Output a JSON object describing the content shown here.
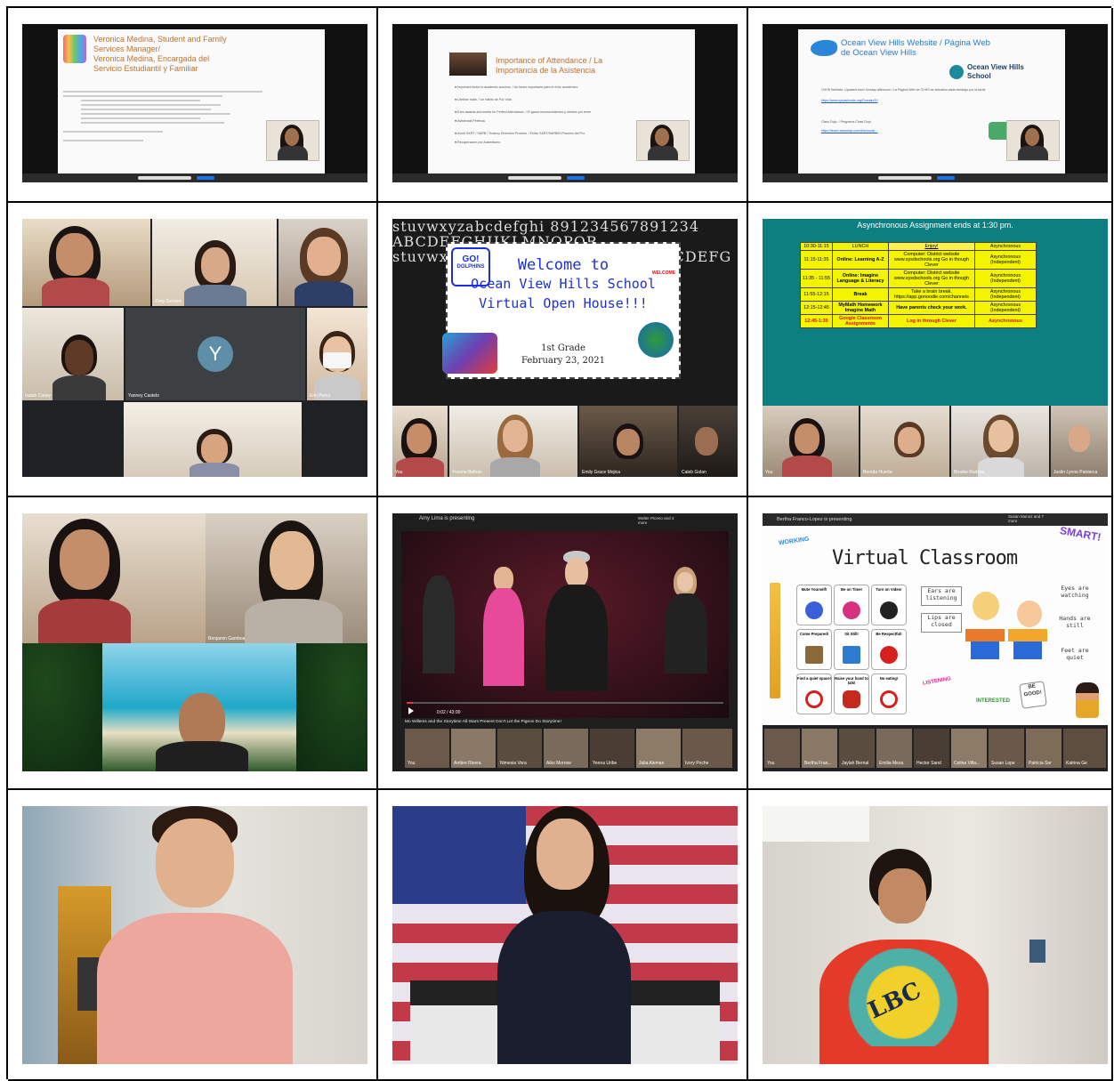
{
  "slide1": {
    "title": "Veronica Medina, Student and Family Services Manager/ Veronica Medina, Encargada del Servicio Estudiantil y Familiar",
    "line1": "Veronica Medina, Student and Family",
    "line2": "Services Manager/",
    "line3": "Veronica Medina, Encargada del",
    "line4": "Servicio Estudiantil y Familiar"
  },
  "slide2": {
    "line1": "Importance of Attendance / La",
    "line2": "Importancia de la Asistencia",
    "bullets": [
      "Important factor to academic success. / Un factor importante para el éxito académico.",
      "Lifetime habit. / Un hábito de Por Vida",
      "Earn awards and merits for Perfect Attendance. / El ganar reconocimientos y méritos por tener",
      "Asistencia Perfecta.",
      "Avoid SART / SARB / Truancy Diversion Process. / Evitar SART/SARB/El Proceso del Pro",
      "Recuperación por Ausentismo."
    ]
  },
  "slide3": {
    "line1": "Ocean View Hills Website / Página Web",
    "line2": "de Ocean View Hills",
    "logo1": "Ocean View Hills",
    "logo2": "School",
    "text1": "OVHS Website- Updated each Sunday afternoon / La Página Web de OVHS se actualiza cada domingo por la tarde",
    "link1": "https://www.sysdschools.org/Domain/10",
    "text2": "Class Dojo- / Programa Class Dojo",
    "link2": "https://teach.classdojo.com/#/schools/..."
  },
  "meet1": {
    "names": [
      "Zoey Serrano",
      "Isaiah Casey",
      "Yanney Castelo",
      "Erin Perez"
    ],
    "avatar_letter": "Y"
  },
  "welcome": {
    "badge_top": "GO!",
    "badge_bottom": "DOLPHINS",
    "l1": "Welcome to",
    "l2": "Ocean View Hills School",
    "l3": "Virtual Open House!!!",
    "grade": "1st Grade",
    "date": "February 23, 2021",
    "stamp": "WELCOME",
    "chalk": "stuvwxyzabcdefghi 891234567891234 ABCDEFGHIJKLMNOPQR stuvwxyzabcdefgh 912345678 ZABCDEFG",
    "names": [
      "You",
      "Yvonne Beltran",
      "Emily Grace Mojica",
      "Caleb Golan"
    ]
  },
  "schedule": {
    "header": "Asynchronous Assignment ends at 1:30 pm.",
    "rows": [
      [
        "10:30-11:15",
        "LUNCH",
        "Enjoy!",
        "Asynchronous"
      ],
      [
        "11:15-11:35",
        "Online: Learning A-Z",
        "Computer: District website www.sysdschools.org Go in though Clever",
        "Asynchronous (Independent)"
      ],
      [
        "11:35 - 11:55",
        "Online: Imagine Language & Literacy",
        "Computer: District website www.sysdschools.org Go in though Clever",
        "Asynchronous (Independent)"
      ],
      [
        "11:55-12:15",
        "Break",
        "Take a brain break, https://app.gonoodle.com/channels",
        "Asynchronous (Independent)"
      ],
      [
        "12:15-12:45",
        "MyMath Homework Imagine Math",
        "Have parents check your work.",
        "Asynchronous (Independent)"
      ],
      [
        "12:45-1:30",
        "Google Classroom Assignments",
        "Log in through Clever",
        "Asynchronous"
      ]
    ],
    "names": [
      "You",
      "Brenda Huerta",
      "Brooke Rudzya",
      "Justin Lynne Patriarca"
    ]
  },
  "meet2": {
    "name": "Benjamin Gamboa"
  },
  "storytime": {
    "presenting": "Amy Lima is presenting",
    "participants": "Walter Piceno and 4 more",
    "video_title": "Mo Willems and the Storytime All-Stars Present Don't Let the Pigeon Do Storytime!",
    "time": "0:02 / 43:00",
    "names": [
      "You",
      "Ambre Rivera",
      "Nimesia Vora",
      "Aiko Morrow",
      "Yenna Uribe",
      "Julia Aleman",
      "Ivory Poche"
    ]
  },
  "classroom": {
    "presenting": "Bertha Franco-Lopez is presenting",
    "participants": "Susan Munoz and 7 more",
    "working": "WORKING",
    "title": "Virtual Classroom",
    "smart": "SMART!",
    "boxes": [
      {
        "label": "Mute Yourself!",
        "color": "#3a5fd8"
      },
      {
        "label": "Be on Time!",
        "color": "#d6307e"
      },
      {
        "label": "Turn on Video!",
        "color": "#222222"
      },
      {
        "label": "Come Prepared!",
        "color": "#8a6a3a"
      },
      {
        "label": "Sit Still!",
        "color": "#2e7bd1"
      },
      {
        "label": "Be Respectful!",
        "color": "#d61f1f"
      },
      {
        "label": "Find a quiet space!",
        "color": "#d61f1f"
      },
      {
        "label": "Raise your hand to talk!",
        "color": "#c62a1f"
      },
      {
        "label": "No eating!",
        "color": "#d61f1f"
      }
    ],
    "ears": "Ears are listening",
    "lips": "Lips are closed",
    "eyes": "Eyes are watching",
    "hands": "Hands are still",
    "feet": "Feet are quiet",
    "listening": "LISTENING",
    "interested": "INTERESTED",
    "begood": "BE GOOD!",
    "names": [
      "You",
      "Bertha Fran...",
      "Jaylah Bernal",
      "Emilia Meza",
      "Hector Sand",
      "Celina Villa...",
      "Susan Lope",
      "Patricia Sor",
      "Katrina Ge"
    ]
  },
  "belt": {
    "text": "LBC"
  }
}
